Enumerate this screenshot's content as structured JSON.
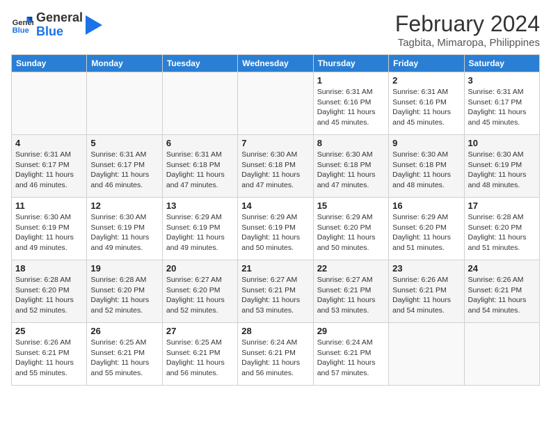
{
  "header": {
    "logo_line1": "General",
    "logo_line2": "Blue",
    "title": "February 2024",
    "subtitle": "Tagbita, Mimaropa, Philippines"
  },
  "weekdays": [
    "Sunday",
    "Monday",
    "Tuesday",
    "Wednesday",
    "Thursday",
    "Friday",
    "Saturday"
  ],
  "weeks": [
    [
      {
        "day": "",
        "sunrise": "",
        "sunset": "",
        "daylight": "",
        "empty": true
      },
      {
        "day": "",
        "sunrise": "",
        "sunset": "",
        "daylight": "",
        "empty": true
      },
      {
        "day": "",
        "sunrise": "",
        "sunset": "",
        "daylight": "",
        "empty": true
      },
      {
        "day": "",
        "sunrise": "",
        "sunset": "",
        "daylight": "",
        "empty": true
      },
      {
        "day": "1",
        "sunrise": "Sunrise: 6:31 AM",
        "sunset": "Sunset: 6:16 PM",
        "daylight": "Daylight: 11 hours and 45 minutes.",
        "empty": false
      },
      {
        "day": "2",
        "sunrise": "Sunrise: 6:31 AM",
        "sunset": "Sunset: 6:16 PM",
        "daylight": "Daylight: 11 hours and 45 minutes.",
        "empty": false
      },
      {
        "day": "3",
        "sunrise": "Sunrise: 6:31 AM",
        "sunset": "Sunset: 6:17 PM",
        "daylight": "Daylight: 11 hours and 45 minutes.",
        "empty": false
      }
    ],
    [
      {
        "day": "4",
        "sunrise": "Sunrise: 6:31 AM",
        "sunset": "Sunset: 6:17 PM",
        "daylight": "Daylight: 11 hours and 46 minutes.",
        "empty": false
      },
      {
        "day": "5",
        "sunrise": "Sunrise: 6:31 AM",
        "sunset": "Sunset: 6:17 PM",
        "daylight": "Daylight: 11 hours and 46 minutes.",
        "empty": false
      },
      {
        "day": "6",
        "sunrise": "Sunrise: 6:31 AM",
        "sunset": "Sunset: 6:18 PM",
        "daylight": "Daylight: 11 hours and 47 minutes.",
        "empty": false
      },
      {
        "day": "7",
        "sunrise": "Sunrise: 6:30 AM",
        "sunset": "Sunset: 6:18 PM",
        "daylight": "Daylight: 11 hours and 47 minutes.",
        "empty": false
      },
      {
        "day": "8",
        "sunrise": "Sunrise: 6:30 AM",
        "sunset": "Sunset: 6:18 PM",
        "daylight": "Daylight: 11 hours and 47 minutes.",
        "empty": false
      },
      {
        "day": "9",
        "sunrise": "Sunrise: 6:30 AM",
        "sunset": "Sunset: 6:18 PM",
        "daylight": "Daylight: 11 hours and 48 minutes.",
        "empty": false
      },
      {
        "day": "10",
        "sunrise": "Sunrise: 6:30 AM",
        "sunset": "Sunset: 6:19 PM",
        "daylight": "Daylight: 11 hours and 48 minutes.",
        "empty": false
      }
    ],
    [
      {
        "day": "11",
        "sunrise": "Sunrise: 6:30 AM",
        "sunset": "Sunset: 6:19 PM",
        "daylight": "Daylight: 11 hours and 49 minutes.",
        "empty": false
      },
      {
        "day": "12",
        "sunrise": "Sunrise: 6:30 AM",
        "sunset": "Sunset: 6:19 PM",
        "daylight": "Daylight: 11 hours and 49 minutes.",
        "empty": false
      },
      {
        "day": "13",
        "sunrise": "Sunrise: 6:29 AM",
        "sunset": "Sunset: 6:19 PM",
        "daylight": "Daylight: 11 hours and 49 minutes.",
        "empty": false
      },
      {
        "day": "14",
        "sunrise": "Sunrise: 6:29 AM",
        "sunset": "Sunset: 6:19 PM",
        "daylight": "Daylight: 11 hours and 50 minutes.",
        "empty": false
      },
      {
        "day": "15",
        "sunrise": "Sunrise: 6:29 AM",
        "sunset": "Sunset: 6:20 PM",
        "daylight": "Daylight: 11 hours and 50 minutes.",
        "empty": false
      },
      {
        "day": "16",
        "sunrise": "Sunrise: 6:29 AM",
        "sunset": "Sunset: 6:20 PM",
        "daylight": "Daylight: 11 hours and 51 minutes.",
        "empty": false
      },
      {
        "day": "17",
        "sunrise": "Sunrise: 6:28 AM",
        "sunset": "Sunset: 6:20 PM",
        "daylight": "Daylight: 11 hours and 51 minutes.",
        "empty": false
      }
    ],
    [
      {
        "day": "18",
        "sunrise": "Sunrise: 6:28 AM",
        "sunset": "Sunset: 6:20 PM",
        "daylight": "Daylight: 11 hours and 52 minutes.",
        "empty": false
      },
      {
        "day": "19",
        "sunrise": "Sunrise: 6:28 AM",
        "sunset": "Sunset: 6:20 PM",
        "daylight": "Daylight: 11 hours and 52 minutes.",
        "empty": false
      },
      {
        "day": "20",
        "sunrise": "Sunrise: 6:27 AM",
        "sunset": "Sunset: 6:20 PM",
        "daylight": "Daylight: 11 hours and 52 minutes.",
        "empty": false
      },
      {
        "day": "21",
        "sunrise": "Sunrise: 6:27 AM",
        "sunset": "Sunset: 6:21 PM",
        "daylight": "Daylight: 11 hours and 53 minutes.",
        "empty": false
      },
      {
        "day": "22",
        "sunrise": "Sunrise: 6:27 AM",
        "sunset": "Sunset: 6:21 PM",
        "daylight": "Daylight: 11 hours and 53 minutes.",
        "empty": false
      },
      {
        "day": "23",
        "sunrise": "Sunrise: 6:26 AM",
        "sunset": "Sunset: 6:21 PM",
        "daylight": "Daylight: 11 hours and 54 minutes.",
        "empty": false
      },
      {
        "day": "24",
        "sunrise": "Sunrise: 6:26 AM",
        "sunset": "Sunset: 6:21 PM",
        "daylight": "Daylight: 11 hours and 54 minutes.",
        "empty": false
      }
    ],
    [
      {
        "day": "25",
        "sunrise": "Sunrise: 6:26 AM",
        "sunset": "Sunset: 6:21 PM",
        "daylight": "Daylight: 11 hours and 55 minutes.",
        "empty": false
      },
      {
        "day": "26",
        "sunrise": "Sunrise: 6:25 AM",
        "sunset": "Sunset: 6:21 PM",
        "daylight": "Daylight: 11 hours and 55 minutes.",
        "empty": false
      },
      {
        "day": "27",
        "sunrise": "Sunrise: 6:25 AM",
        "sunset": "Sunset: 6:21 PM",
        "daylight": "Daylight: 11 hours and 56 minutes.",
        "empty": false
      },
      {
        "day": "28",
        "sunrise": "Sunrise: 6:24 AM",
        "sunset": "Sunset: 6:21 PM",
        "daylight": "Daylight: 11 hours and 56 minutes.",
        "empty": false
      },
      {
        "day": "29",
        "sunrise": "Sunrise: 6:24 AM",
        "sunset": "Sunset: 6:21 PM",
        "daylight": "Daylight: 11 hours and 57 minutes.",
        "empty": false
      },
      {
        "day": "",
        "sunrise": "",
        "sunset": "",
        "daylight": "",
        "empty": true
      },
      {
        "day": "",
        "sunrise": "",
        "sunset": "",
        "daylight": "",
        "empty": true
      }
    ]
  ]
}
